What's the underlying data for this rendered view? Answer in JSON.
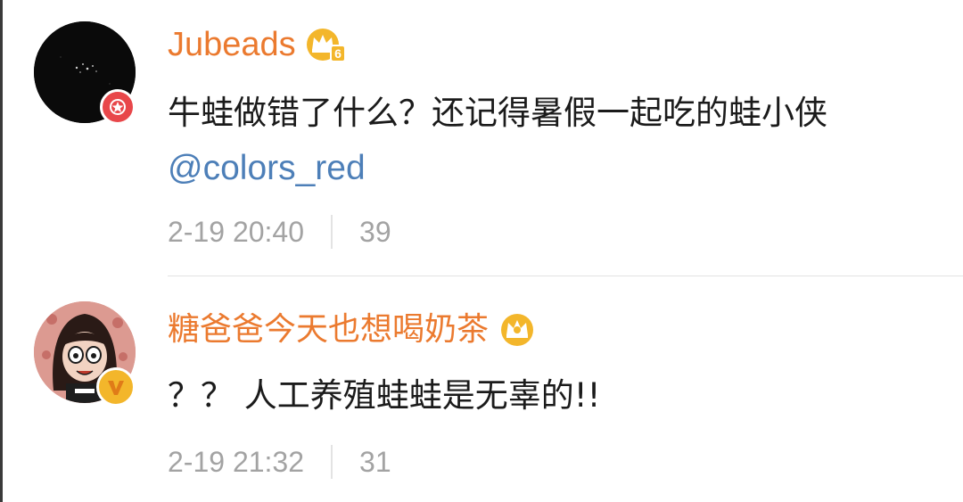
{
  "comments": [
    {
      "username": "Jubeads",
      "crown_level": "6",
      "text": "牛蛙做错了什么？还记得暑假一起吃的蛙小侠",
      "mention": "@colors_red",
      "timestamp": "2-19 20:40",
      "like_count": "39",
      "avatar_badge_icon": "red-star-badge",
      "avatar_color": "#0a0a0a",
      "badge_color": "#e8474a"
    },
    {
      "username": "糖爸爸今天也想喝奶茶",
      "crown_level": "",
      "text": "？？ 人工养殖蛙蛙是无辜的!!",
      "mention": "",
      "timestamp": "2-19 21:32",
      "like_count": "31",
      "avatar_badge_icon": "yellow-v-badge",
      "avatar_color": "#d98f86",
      "badge_color": "#f3b62b"
    }
  ],
  "colors": {
    "username": "#eb7a2f",
    "mention": "#4d7fb8",
    "meta": "#a3a3a3",
    "crown": "#f3b62b"
  }
}
